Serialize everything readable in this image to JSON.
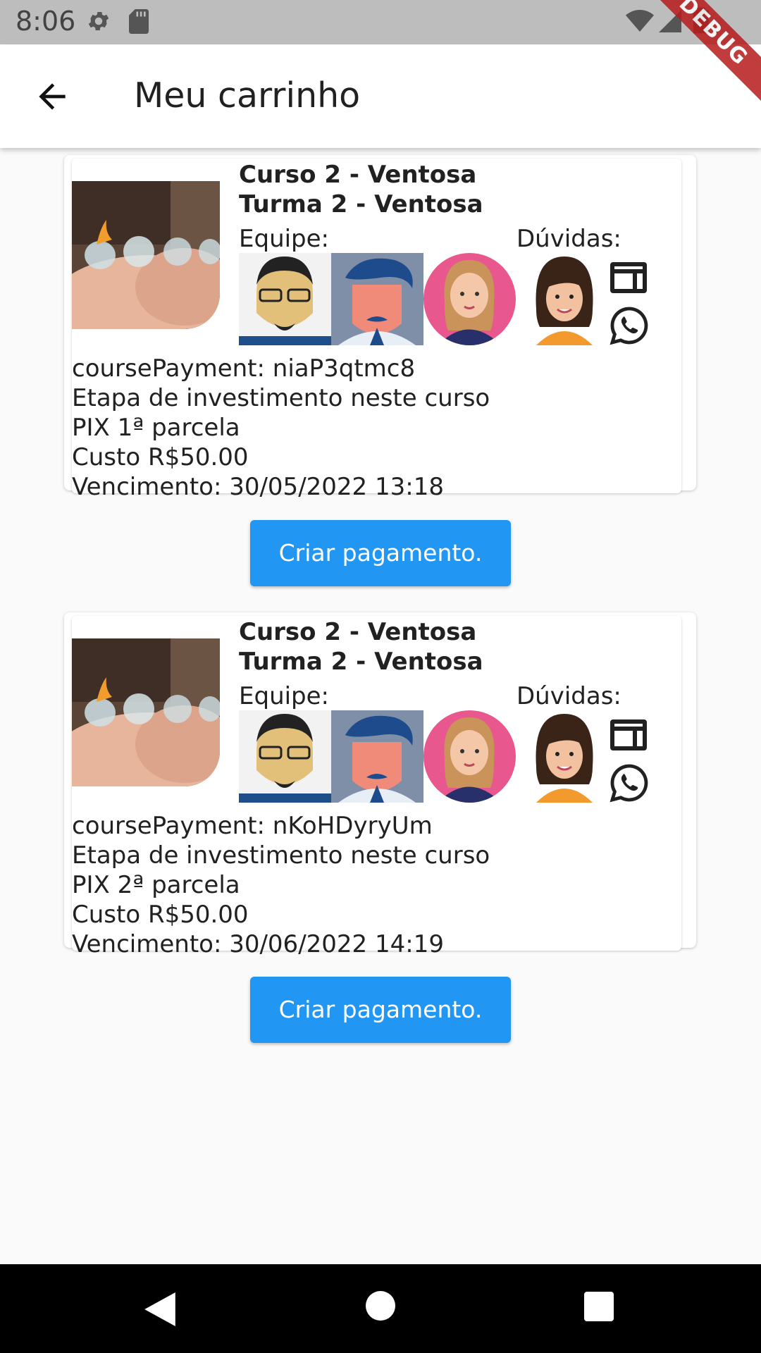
{
  "status_bar": {
    "time": "8:06",
    "debug_label": "DEBUG"
  },
  "app_bar": {
    "title": "Meu carrinho"
  },
  "cart_items": [
    {
      "course_name": "Curso 2 - Ventosa",
      "class_name": "Turma 2 - Ventosa",
      "team_label": "Equipe:",
      "questions_label": "Dúvidas:",
      "course_payment": "coursePayment: niaP3qtmc8",
      "stage": "Etapa de investimento neste curso",
      "installment": "PIX 1ª parcela",
      "cost": "Custo R$50.00",
      "due": "Vencimento: 30/05/2022 13:18",
      "button_label": "Criar pagamento."
    },
    {
      "course_name": "Curso 2 - Ventosa",
      "class_name": "Turma 2 - Ventosa",
      "team_label": "Equipe:",
      "questions_label": "Dúvidas:",
      "course_payment": "coursePayment: nKoHDyryUm",
      "stage": "Etapa de investimento neste curso",
      "installment": "PIX 2ª parcela",
      "cost": "Custo R$50.00",
      "due": "Vencimento: 30/06/2022 14:19",
      "button_label": "Criar pagamento."
    }
  ],
  "colors": {
    "accent": "#2196f3",
    "app_bar": "#ffffff",
    "status_bar": "#bdbdbd",
    "debug_ribbon": "#b71c1c"
  },
  "icons": [
    "settings-icon",
    "sd-card-icon",
    "wifi-icon",
    "signal-icon",
    "battery-icon",
    "back-arrow-icon",
    "web-icon",
    "whatsapp-icon",
    "nav-back-icon",
    "nav-home-icon",
    "nav-recents-icon"
  ]
}
